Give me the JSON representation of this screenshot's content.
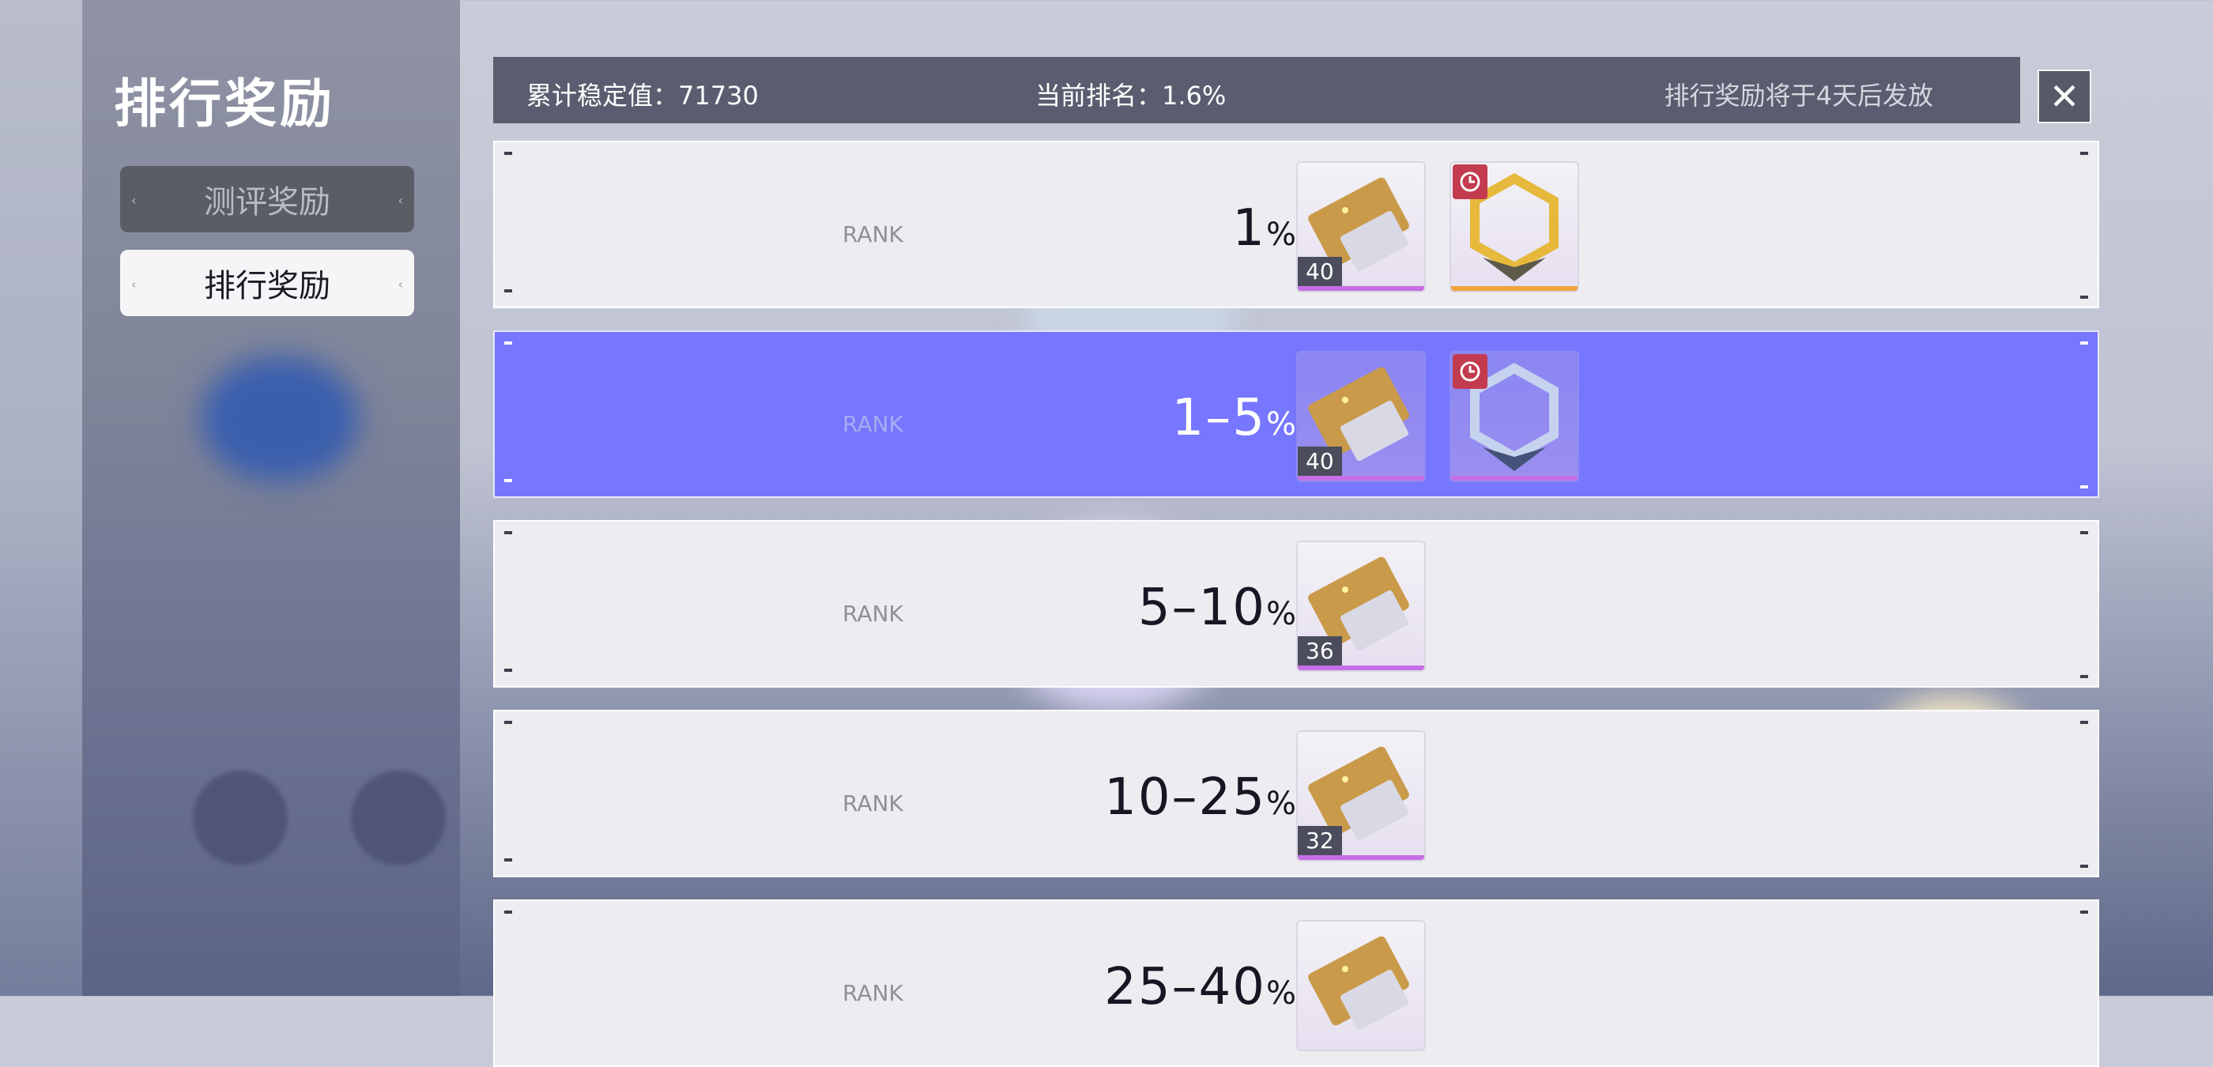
{
  "sidebar": {
    "title": "排行奖励",
    "tabs": [
      {
        "label": "测评奖励",
        "selected": false
      },
      {
        "label": "排行奖励",
        "selected": true
      }
    ]
  },
  "header": {
    "cumulative_label": "累计稳定值：71730",
    "current_rank_label": "当前排名：1.6%",
    "notice": "排行奖励将于4天后发放"
  },
  "close_icon": "✕",
  "rank_label": "RANK",
  "rows": [
    {
      "range": "1",
      "pct": "%",
      "active": false,
      "items": [
        {
          "type": "ticket",
          "count": "40"
        },
        {
          "type": "badge-gold",
          "timed": true
        }
      ]
    },
    {
      "range": "1–5",
      "pct": "%",
      "active": true,
      "items": [
        {
          "type": "ticket",
          "count": "40"
        },
        {
          "type": "badge-silver",
          "timed": true
        }
      ]
    },
    {
      "range": "5–10",
      "pct": "%",
      "active": false,
      "items": [
        {
          "type": "ticket",
          "count": "36"
        }
      ]
    },
    {
      "range": "10–25",
      "pct": "%",
      "active": false,
      "items": [
        {
          "type": "ticket",
          "count": "32"
        }
      ]
    },
    {
      "range": "25–40",
      "pct": "%",
      "active": false,
      "items": [
        {
          "type": "ticket",
          "count": ""
        }
      ]
    }
  ],
  "colors": {
    "active_row": "#7676ff",
    "row": "#ededf1",
    "accent_purple": "#c66ee6",
    "accent_gold": "#f0a23a",
    "timer_red": "#c23b4f"
  }
}
